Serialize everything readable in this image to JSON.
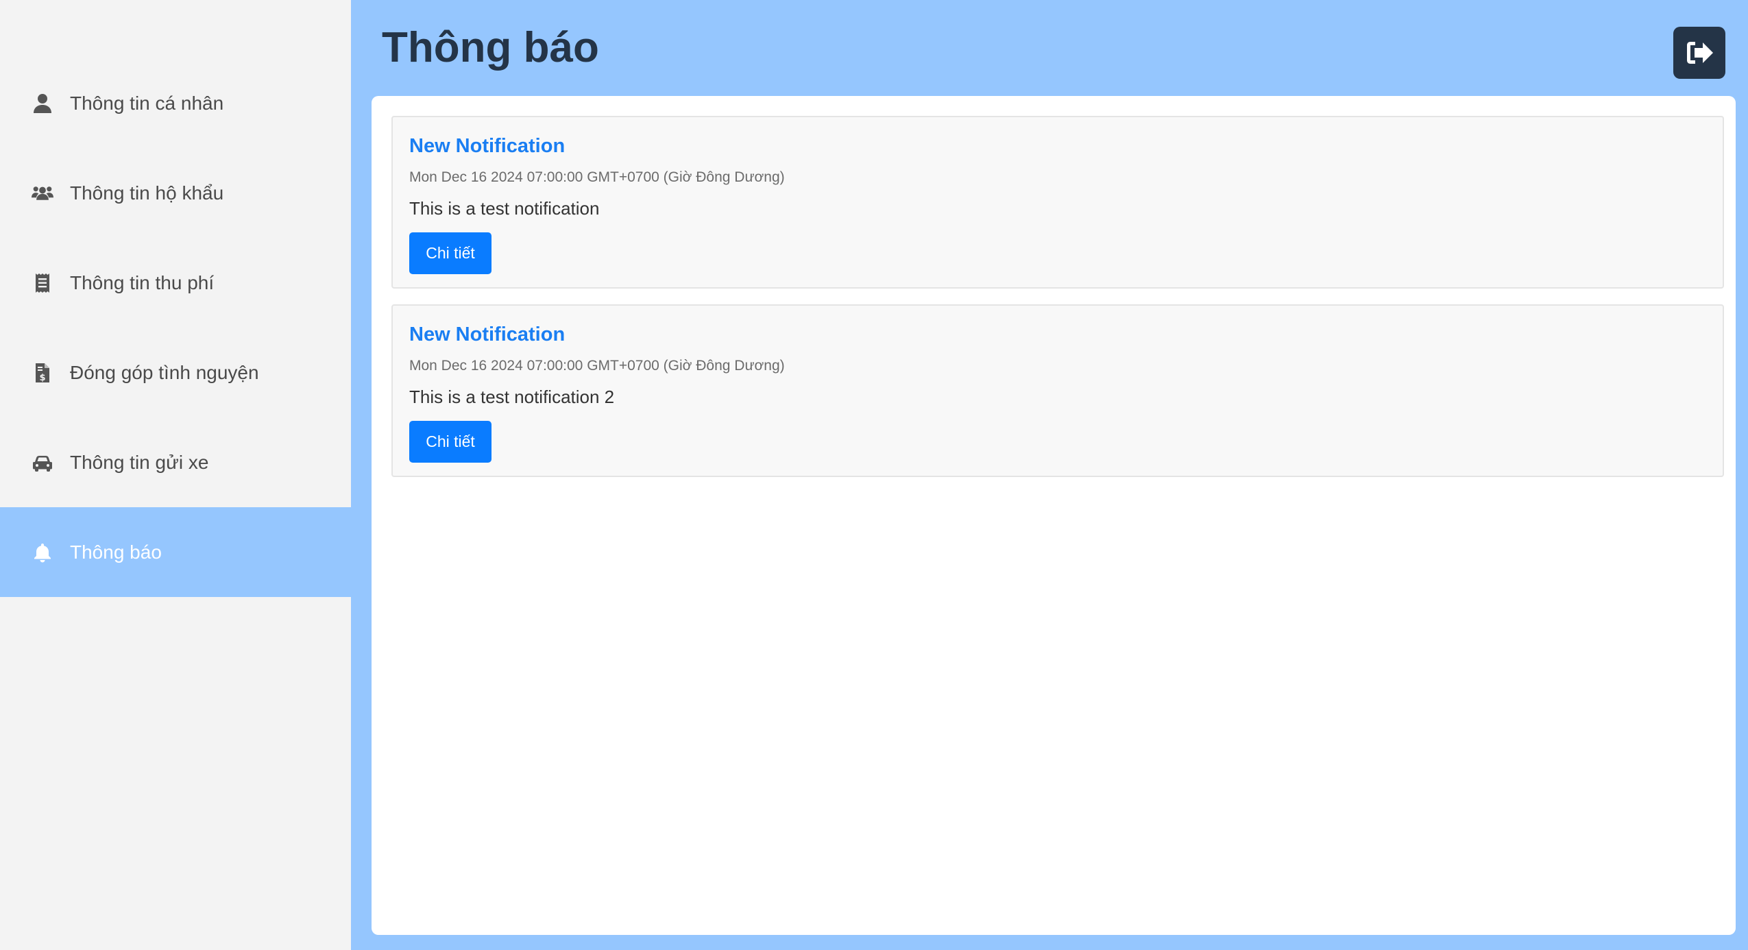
{
  "sidebar": {
    "items": [
      {
        "label": "Thông tin cá nhân",
        "icon": "user-icon"
      },
      {
        "label": "Thông tin hộ khẩu",
        "icon": "users-icon"
      },
      {
        "label": "Thông tin thu phí",
        "icon": "receipt-icon"
      },
      {
        "label": "Đóng góp tình nguyện",
        "icon": "invoice-dollar-icon"
      },
      {
        "label": "Thông tin gửi xe",
        "icon": "car-icon"
      },
      {
        "label": "Thông báo",
        "icon": "bell-icon",
        "active": true
      }
    ]
  },
  "header": {
    "title": "Thông báo",
    "logout_icon": "sign-out-icon"
  },
  "notifications": [
    {
      "title": "New Notification",
      "date": "Mon Dec 16 2024 07:00:00 GMT+0700 (Giờ Đông Dương)",
      "message": "This is a test notification",
      "button_label": "Chi tiết"
    },
    {
      "title": "New Notification",
      "date": "Mon Dec 16 2024 07:00:00 GMT+0700 (Giờ Đông Dương)",
      "message": "This is a test notification 2",
      "button_label": "Chi tiết"
    }
  ],
  "colors": {
    "accent_bg": "#95c6fe",
    "sidebar_bg": "#f3f3f3",
    "title_dark": "#243447",
    "link_blue": "#1a7ef2",
    "button_blue": "#0a7cff"
  }
}
